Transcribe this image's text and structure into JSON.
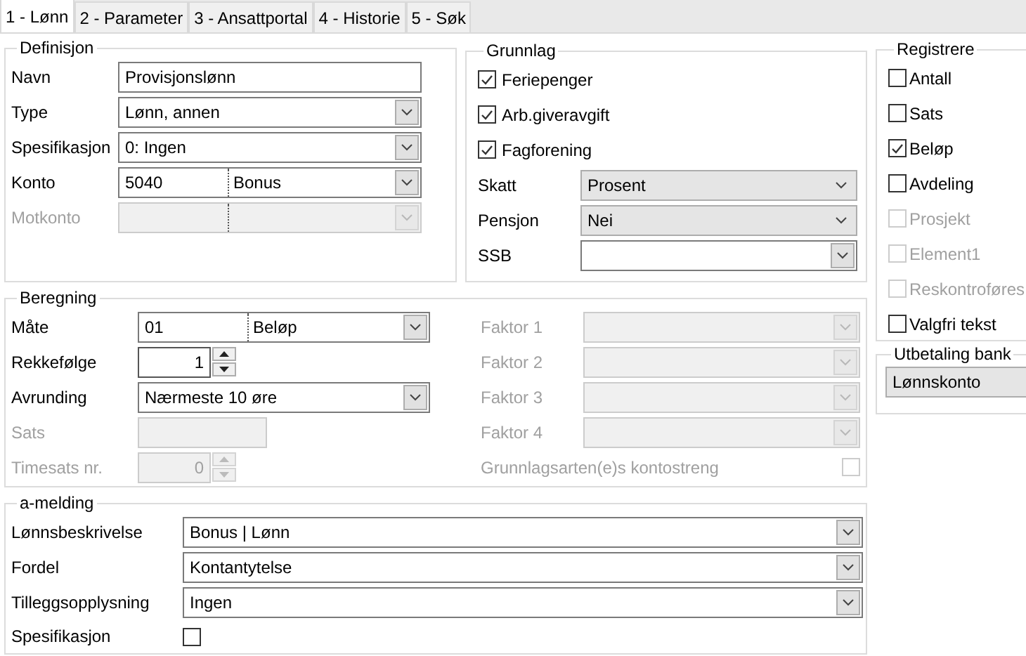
{
  "tabs": [
    {
      "label": "1 - Lønn",
      "selected": true
    },
    {
      "label": "2 - Parameter",
      "selected": false
    },
    {
      "label": "3 - Ansattportal",
      "selected": false
    },
    {
      "label": "4 - Historie",
      "selected": false
    },
    {
      "label": "5 - Søk",
      "selected": false
    }
  ],
  "definisjon": {
    "title": "Definisjon",
    "fields": [
      {
        "label": "Navn",
        "kind": "text",
        "value": "Provisjonslønn",
        "disabled": false
      },
      {
        "label": "Type",
        "kind": "combo",
        "value": "Lønn, annen",
        "disabled": false
      },
      {
        "label": "Spesifikasjon",
        "kind": "combo",
        "value": "0:  Ingen",
        "disabled": false
      },
      {
        "label": "Konto",
        "kind": "split",
        "code": "5040",
        "value": "Bonus",
        "disabled": false
      },
      {
        "label": "Motkonto",
        "kind": "split",
        "disabled": true
      }
    ]
  },
  "grunnlag": {
    "title": "Grunnlag",
    "checkboxes": [
      {
        "label": "Feriepenger",
        "checked": true
      },
      {
        "label": "Arb.giveravgift",
        "checked": true
      },
      {
        "label": "Fagforening",
        "checked": true
      }
    ],
    "fields": [
      {
        "label": "Skatt",
        "kind": "dropdown",
        "value": "Prosent",
        "disabled": false
      },
      {
        "label": "Pensjon",
        "kind": "dropdown",
        "value": "Nei",
        "disabled": false
      },
      {
        "label": "SSB",
        "kind": "combo",
        "disabled": false
      }
    ]
  },
  "registrere": {
    "title": "Registrere",
    "checkboxes": [
      {
        "label": "Antall",
        "checked": false,
        "disabled": false
      },
      {
        "label": "Sats",
        "checked": false,
        "disabled": false
      },
      {
        "label": "Beløp",
        "checked": true,
        "disabled": false
      },
      {
        "label": "Avdeling",
        "checked": false,
        "disabled": false
      },
      {
        "label": "Prosjekt",
        "checked": false,
        "disabled": true
      },
      {
        "label": "Element1",
        "checked": false,
        "disabled": true
      },
      {
        "label": "Reskontroføres",
        "checked": false,
        "disabled": true
      },
      {
        "label": "Valgfri tekst",
        "checked": false,
        "disabled": false
      }
    ]
  },
  "utbetaling_bank": {
    "title": "Utbetaling bank",
    "value": "Lønnskonto"
  },
  "beregning": {
    "title": "Beregning",
    "fields": [
      {
        "label": "Måte",
        "kind": "split",
        "code": "01",
        "value": "Beløp",
        "disabled": false
      },
      {
        "label": "Rekkefølge",
        "kind": "spinner",
        "value": "1",
        "disabled": false
      },
      {
        "label": "Avrunding",
        "kind": "combo",
        "value": "Nærmeste 10 øre",
        "disabled": false
      },
      {
        "label": "Sats",
        "kind": "short",
        "disabled": true
      },
      {
        "label": "Timesats nr.",
        "kind": "spinner",
        "value": "0",
        "disabled": true
      }
    ],
    "faktorer": [
      {
        "label": "Faktor 1",
        "kind": "combo",
        "disabled": true
      },
      {
        "label": "Faktor 2",
        "kind": "combo",
        "disabled": true
      },
      {
        "label": "Faktor 3",
        "kind": "combo",
        "disabled": true
      },
      {
        "label": "Faktor 4",
        "kind": "combo",
        "disabled": true
      }
    ],
    "kontostreng": {
      "label": "Grunnlagsarten(e)s kontostreng",
      "checked": false,
      "disabled": true
    }
  },
  "a_melding": {
    "title": "a-melding",
    "fields": [
      {
        "label": "Lønnsbeskrivelse",
        "kind": "combo",
        "value": "Bonus | Lønn",
        "disabled": false
      },
      {
        "label": "Fordel",
        "kind": "combo",
        "value": "Kontantytelse",
        "disabled": false
      },
      {
        "label": "Tilleggsopplysning",
        "kind": "combo",
        "value": "Ingen",
        "disabled": false
      }
    ],
    "spesifikasjon": {
      "label": "Spesifikasjon",
      "checked": false
    }
  }
}
